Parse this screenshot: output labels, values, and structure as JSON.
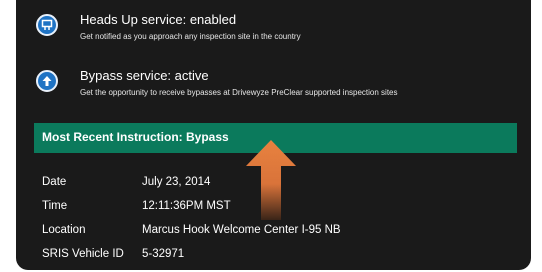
{
  "services": [
    {
      "icon": "heads-up-icon",
      "title": "Heads Up service: enabled",
      "description": "Get notified as you approach any inspection site in the country"
    },
    {
      "icon": "bypass-arrow-icon",
      "title": "Bypass service: active",
      "description": "Get the opportunity to receive bypasses at Drivewyze PreClear supported inspection sites"
    }
  ],
  "instruction": {
    "title": "Most Recent Instruction: Bypass",
    "accent_color": "#0b7a5c"
  },
  "details": [
    {
      "label": "Date",
      "value": "July 23, 2014"
    },
    {
      "label": "Time",
      "value": "12:11:36PM MST"
    },
    {
      "label": "Location",
      "value": "Marcus Hook Welcome Center I-95 NB"
    },
    {
      "label": "SRIS Vehicle ID",
      "value": "5-32971"
    }
  ],
  "colors": {
    "panel_bg": "#1a1a1a",
    "icon_blue": "#1f73c4",
    "highlight_arrow": "#e8823f"
  }
}
